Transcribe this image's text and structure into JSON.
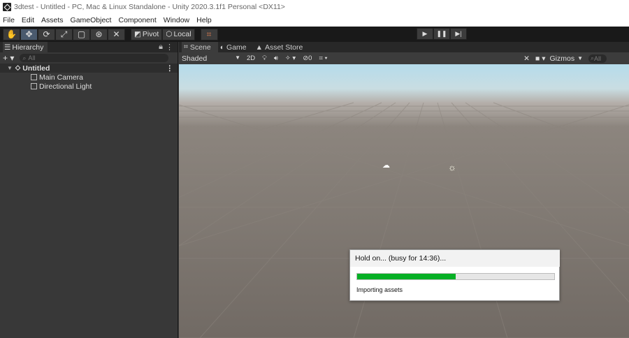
{
  "window": {
    "title": "3dtest - Untitled - PC, Mac & Linux Standalone - Unity 2020.3.1f1 Personal <DX11>"
  },
  "menu": [
    "File",
    "Edit",
    "Assets",
    "GameObject",
    "Component",
    "Window",
    "Help"
  ],
  "toolbar": {
    "pivot_label": "Pivot",
    "local_label": "Local"
  },
  "hierarchy": {
    "tab_label": "Hierarchy",
    "search_placeholder": "All",
    "scene_name": "Untitled",
    "items": [
      {
        "label": "Main Camera"
      },
      {
        "label": "Directional Light"
      }
    ]
  },
  "scene": {
    "tabs": [
      {
        "label": "Scene"
      },
      {
        "label": "Game"
      },
      {
        "label": "Asset Store"
      }
    ],
    "shading_mode": "Shaded",
    "mode_2d": "2D",
    "hidden_count": "0",
    "gizmos_label": "Gizmos",
    "search_placeholder": "All"
  },
  "dialog": {
    "title": "Hold on... (busy for 14:36)...",
    "progress": 0.5,
    "message": "Importing assets",
    "progress_color": "#06b025"
  }
}
